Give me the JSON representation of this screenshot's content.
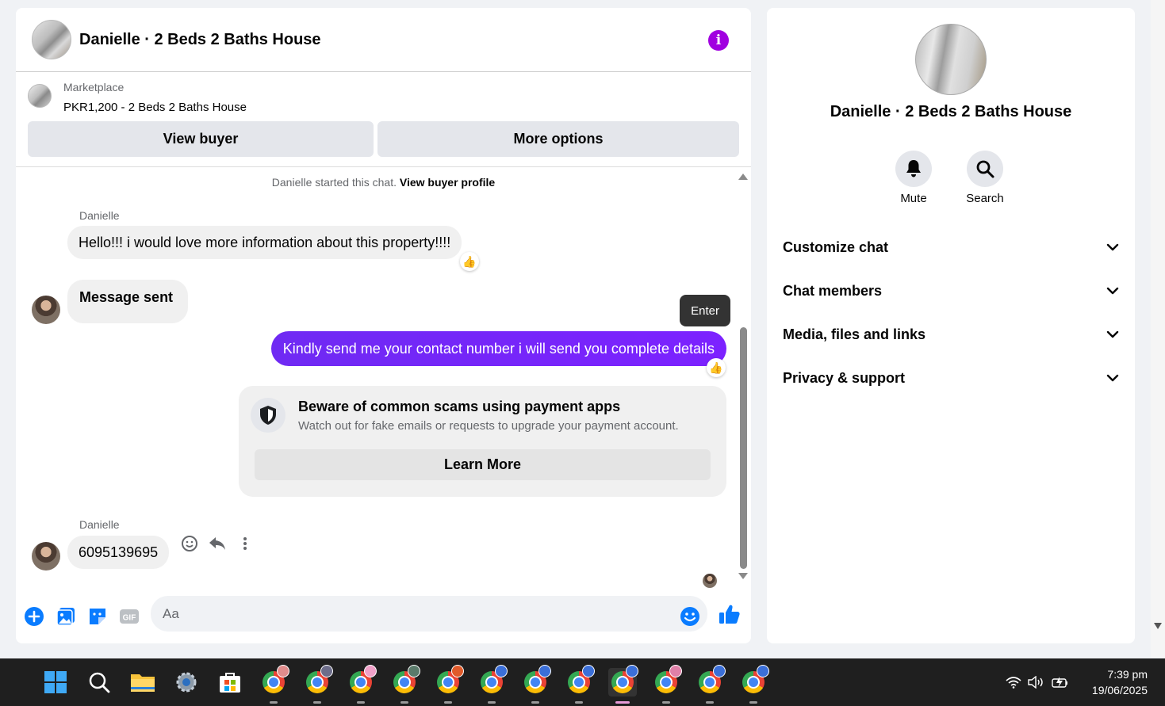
{
  "chat": {
    "title": "Danielle · 2 Beds 2 Baths House",
    "marketplace": {
      "label": "Marketplace",
      "listing": "PKR1,200 - 2 Beds 2 Baths House",
      "view_buyer": "View buyer",
      "more_options": "More options"
    },
    "system_note": "Danielle started this chat.",
    "system_link": "View buyer profile",
    "messages": [
      {
        "sender": "Danielle",
        "text": "Hello!!! i would love more information about this property!!!!",
        "reaction": "👍"
      },
      {
        "text": "Message sent"
      },
      {
        "text": "Kindly send me your contact number i will send you complete details",
        "reaction": "👍"
      },
      {
        "sender": "Danielle",
        "text": "6095139695"
      }
    ],
    "tooltip": "Enter",
    "scam_card": {
      "title": "Beware of common scams using payment apps",
      "text": "Watch out for fake emails or requests to upgrade your payment account.",
      "button": "Learn More"
    },
    "composer": {
      "placeholder": "Aa",
      "gif_label": "GIF"
    }
  },
  "side": {
    "title": "Danielle · 2 Beds 2 Baths House",
    "actions": [
      {
        "label": "Mute",
        "icon": "bell-icon"
      },
      {
        "label": "Search",
        "icon": "search-icon"
      }
    ],
    "sections": [
      {
        "label": "Customize chat"
      },
      {
        "label": "Chat members"
      },
      {
        "label": "Media, files and links"
      },
      {
        "label": "Privacy & support"
      }
    ]
  },
  "taskbar": {
    "time": "7:39 pm",
    "date": "19/06/2025"
  },
  "colors": {
    "accent": "#7a1dff",
    "messenger_blue": "#0a7cff",
    "info": "#a100e0"
  }
}
